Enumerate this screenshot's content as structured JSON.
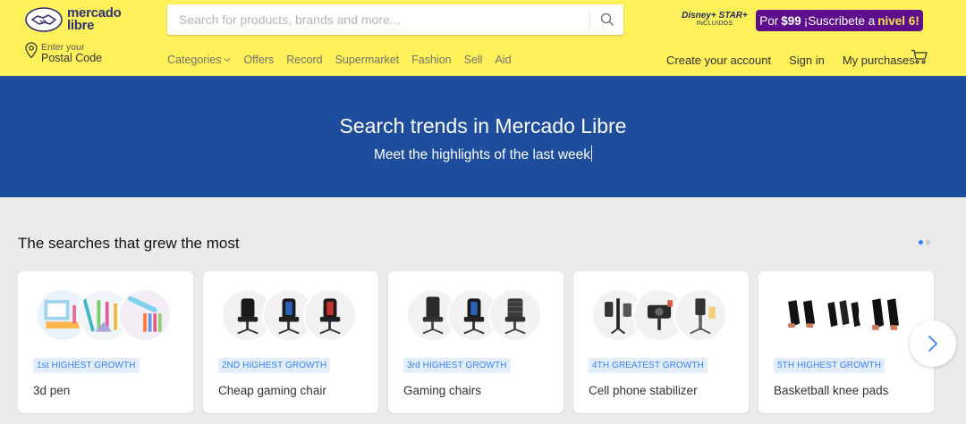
{
  "header": {
    "logo": {
      "line1": "mercado",
      "line2": "libre"
    },
    "search": {
      "placeholder": "Search for products, brands and more...",
      "value": ""
    },
    "promo": {
      "disney_logo": "Disney+ STAR+",
      "disney_sub": "INCLUIDOS",
      "badge_prefix": "Por",
      "badge_price": "$99",
      "badge_text": "¡Suscribete a",
      "badge_level": "nivel 6",
      "badge_suffix": "!"
    },
    "postal": {
      "small": "Enter your",
      "big": "Postal Code"
    },
    "nav": [
      "Categories",
      "Offers",
      "Record",
      "Supermarket",
      "Fashion",
      "Sell",
      "Aid"
    ],
    "account": {
      "create": "Create your account",
      "signin": "Sign in",
      "purchases": "My purchases"
    },
    "colors": {
      "header_bg": "#fff159",
      "brand_navy": "#2d3277",
      "promo_purple": "#5e0e8c"
    }
  },
  "hero": {
    "title": "Search trends in Mercado Libre",
    "subtitle": "Meet the highlights of the last week",
    "bg": "#1d4d9c"
  },
  "section": {
    "title": "The searches that grew the most",
    "pager": {
      "count": 2,
      "active": 1
    },
    "cards": [
      {
        "tag": "1st HIGHEST GROWTH",
        "title": "3d pen"
      },
      {
        "tag": "2ND HIGHEST GROWTH",
        "title": "Cheap gaming chair"
      },
      {
        "tag": "3rd HIGHEST GROWTH",
        "title": "Gaming chairs"
      },
      {
        "tag": "4TH GREATEST GROWTH",
        "title": "Cell phone stabilizer"
      },
      {
        "tag": "5TH HIGHEST GROWTH",
        "title": "Basketball knee pads"
      }
    ],
    "accent": "#3483fa"
  },
  "icons": {
    "search": "search-icon",
    "location": "location-pin-icon",
    "cart": "cart-icon",
    "chevron_down": "chevron-down-icon",
    "next": "chevron-right-icon"
  }
}
